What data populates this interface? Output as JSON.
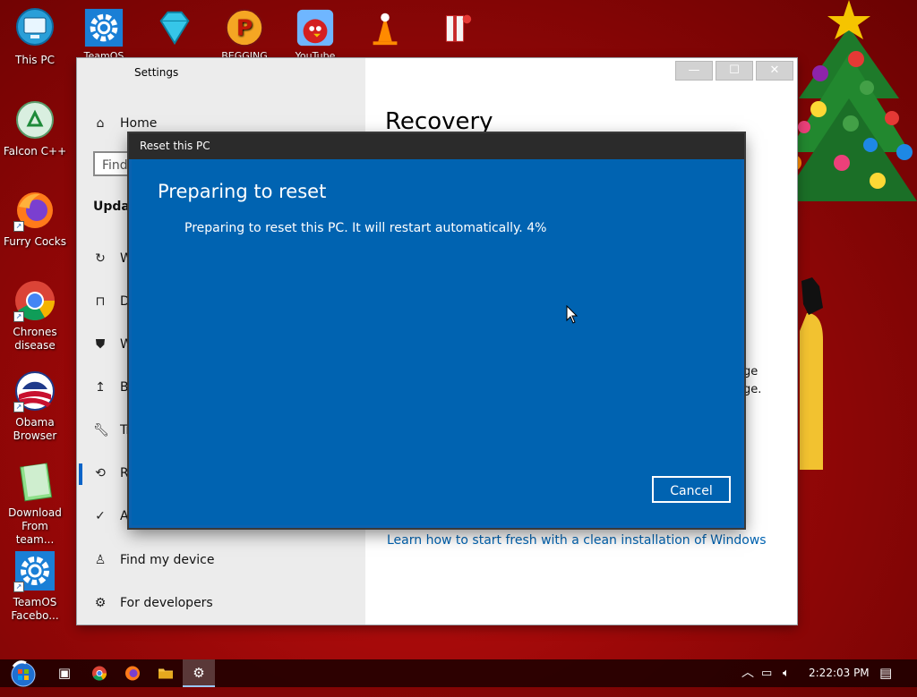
{
  "desktop": {
    "left_icons": [
      {
        "label": "This PC",
        "icon": "this-pc-icon"
      },
      {
        "label": "Falcon C++",
        "icon": "recycle-bin-icon"
      },
      {
        "label": "Furry Cocks",
        "icon": "firefox-icon"
      },
      {
        "label": "Chrones disease",
        "icon": "chrome-icon"
      },
      {
        "label": "Obama Browser",
        "icon": "obama-logo-icon"
      },
      {
        "label": "Download From team...",
        "icon": "notepad-icon"
      },
      {
        "label": "TeamOS Facebo...",
        "icon": "gear-icon"
      }
    ],
    "top_icons": [
      {
        "label": "TeamOS",
        "icon": "gear-icon"
      },
      {
        "label": "",
        "icon": "diamond-icon"
      },
      {
        "label": "BEGGING LOL",
        "icon": "p-logo-icon"
      },
      {
        "label": "YouTube",
        "icon": "angry-bird-icon"
      },
      {
        "label": "",
        "icon": "traffic-cone-icon"
      },
      {
        "label": "",
        "icon": "gift-icon"
      }
    ]
  },
  "settings": {
    "window_title": "Settings",
    "nav": {
      "home": "Home",
      "search_placeholder": "Find",
      "section_heading": "Updat",
      "items": [
        "W",
        "D",
        "W",
        "B",
        "Tr",
        "R",
        "A",
        "Find my device",
        "For developers"
      ]
    },
    "page_title": "Recovery",
    "partial_text": [
      "ge",
      "ge."
    ],
    "link": "Learn how to start fresh with a clean installation of Windows"
  },
  "dialog": {
    "title": "Reset this PC",
    "heading": "Preparing to reset",
    "message": "Preparing to reset this PC. It will restart automatically. 4%",
    "progress_percent": 4,
    "cancel_label": "Cancel"
  },
  "taskbar": {
    "clock": "2:22:03 PM",
    "apps": [
      "start-orb-icon",
      "task-view-icon",
      "chrome-icon",
      "firefox-icon",
      "file-explorer-icon",
      "settings-gear-icon"
    ]
  },
  "colors": {
    "dialog_blue": "#0063b1",
    "link_blue": "#0063b1",
    "accent": "#0a64c8",
    "desktop_red": "#b30c0c"
  }
}
